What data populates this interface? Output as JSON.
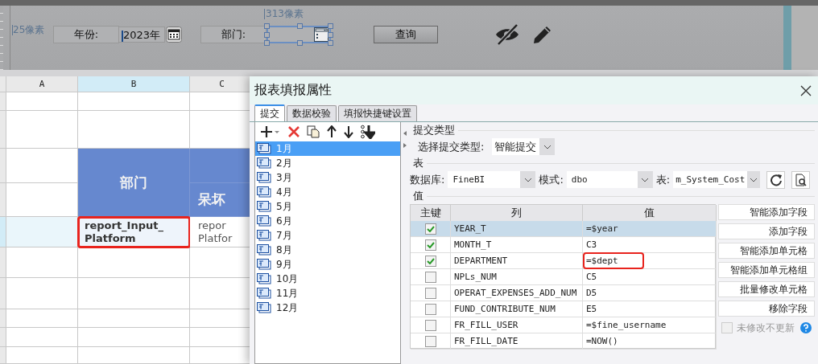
{
  "designer": {
    "width_label": "313像素",
    "height_label": "25像素",
    "params": [
      {
        "kind": "label",
        "text": "年份:"
      },
      {
        "kind": "date",
        "value": "2023年"
      },
      {
        "kind": "label",
        "text": "部门:"
      },
      {
        "kind": "combo",
        "selected": true
      },
      {
        "kind": "button",
        "text": "查询"
      }
    ]
  },
  "sheet": {
    "columns": [
      {
        "label": "A",
        "selected": false
      },
      {
        "label": "B",
        "selected": true
      },
      {
        "label": "C",
        "selected": false
      }
    ],
    "header_cells": [
      "部门",
      "呆坏"
    ],
    "input_row": {
      "selected": true,
      "cells": [
        {
          "lines": [
            "report_Input_",
            "Platform"
          ],
          "highlighted": true
        },
        {
          "lines": [
            "repor",
            "Platfor"
          ],
          "highlighted": false
        }
      ]
    }
  },
  "dialog": {
    "title": "报表填报属性",
    "tabs": [
      {
        "label": "提交",
        "selected": true
      },
      {
        "label": "数据校验",
        "selected": false
      },
      {
        "label": "填报快捷键设置",
        "selected": false
      }
    ],
    "submissions": [
      {
        "label": "1月",
        "selected": true
      },
      {
        "label": "2月",
        "selected": false
      },
      {
        "label": "3月",
        "selected": false
      },
      {
        "label": "4月",
        "selected": false
      },
      {
        "label": "5月",
        "selected": false
      },
      {
        "label": "6月",
        "selected": false
      },
      {
        "label": "7月",
        "selected": false
      },
      {
        "label": "8月",
        "selected": false
      },
      {
        "label": "9月",
        "selected": false
      },
      {
        "label": "10月",
        "selected": false
      },
      {
        "label": "11月",
        "selected": false
      },
      {
        "label": "12月",
        "selected": false
      }
    ],
    "submit_type": {
      "heading": "提交类型",
      "field_label": "选择提交类型:",
      "value": "智能提交"
    },
    "table_section": {
      "heading": "表",
      "database_label": "数据库:",
      "database": "FineBI",
      "schema_label": "模式:",
      "schema": "dbo",
      "table_label": "表:",
      "table": "m_System_Cost"
    },
    "values": {
      "heading": "值",
      "columns": [
        "主键",
        "列",
        "值"
      ],
      "rows": [
        {
          "primary_key": true,
          "column": "YEAR_T",
          "value": "=$year",
          "selected": true,
          "highlighted": false
        },
        {
          "primary_key": true,
          "column": "MONTH_T",
          "value": "C3",
          "selected": false,
          "highlighted": false
        },
        {
          "primary_key": true,
          "column": "DEPARTMENT",
          "value": "=$dept",
          "selected": false,
          "highlighted": true
        },
        {
          "primary_key": false,
          "column": "NPLs_NUM",
          "value": "C5",
          "selected": false,
          "highlighted": false
        },
        {
          "primary_key": false,
          "column": "OPERAT_EXPENSES_ADD_NUM",
          "value": "D5",
          "selected": false,
          "highlighted": false
        },
        {
          "primary_key": false,
          "column": "FUND_CONTRIBUTE_NUM",
          "value": "E5",
          "selected": false,
          "highlighted": false
        },
        {
          "primary_key": false,
          "column": "FR_FILL_USER",
          "value": "=$fine_username",
          "selected": false,
          "highlighted": false
        },
        {
          "primary_key": false,
          "column": "FR_FILL_DATE",
          "value": "=NOW()",
          "selected": false,
          "highlighted": false
        }
      ]
    },
    "buttons": [
      "智能添加字段",
      "添加字段",
      "智能添加单元格",
      "智能添加单元格组",
      "批量修改单元格",
      "移除字段"
    ],
    "option": {
      "label": "未修改不更新",
      "checked": false,
      "disabled": true
    }
  }
}
